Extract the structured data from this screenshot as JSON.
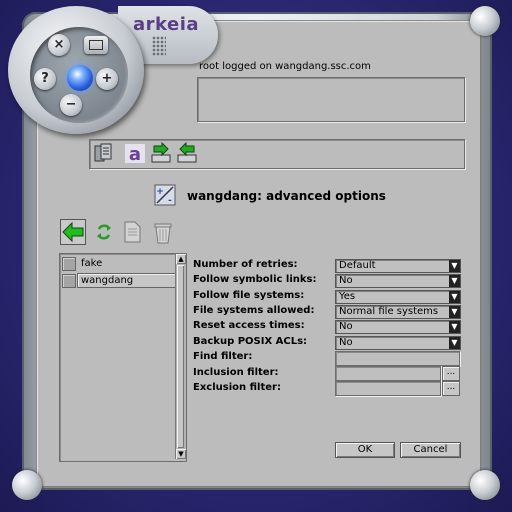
{
  "app": {
    "brand": "arkeia"
  },
  "status": {
    "logged_on": "root logged on wangdang.ssc.com"
  },
  "page": {
    "title": "wangdang: advanced options"
  },
  "disc": {
    "buttons": [
      {
        "glyph": "×",
        "icon": "close-icon"
      },
      {
        "glyph": "?",
        "icon": "help-icon"
      },
      {
        "glyph": "+",
        "icon": "add-icon"
      },
      {
        "glyph": "−",
        "icon": "minus-icon"
      }
    ]
  },
  "hosts": [
    {
      "label": "fake",
      "selected": false
    },
    {
      "label": "wangdang",
      "selected": true
    }
  ],
  "options": {
    "number_of_retries": {
      "label": "Number of retries:",
      "value": "Default"
    },
    "follow_symbolic_links": {
      "label": "Follow symbolic links:",
      "value": "No"
    },
    "follow_file_systems": {
      "label": "Follow file systems:",
      "value": "Yes"
    },
    "file_systems_allowed": {
      "label": "File systems allowed:",
      "value": "Normal file systems"
    },
    "reset_access_times": {
      "label": "Reset access times:",
      "value": "No"
    },
    "backup_posix_acls": {
      "label": "Backup POSIX ACLs:",
      "value": "No"
    },
    "find_filter": {
      "label": "Find filter:",
      "value": ""
    },
    "inclusion_filter": {
      "label": "Inclusion filter:",
      "value": ""
    },
    "exclusion_filter": {
      "label": "Exclusion filter:",
      "value": ""
    }
  },
  "ellipsis_label": "...",
  "buttons": {
    "ok": "OK",
    "cancel": "Cancel"
  },
  "colors": {
    "background": "#2a2670",
    "panel": "#bcbcbc",
    "brand": "#5a3f86",
    "back_arrow": "#22aa22"
  }
}
